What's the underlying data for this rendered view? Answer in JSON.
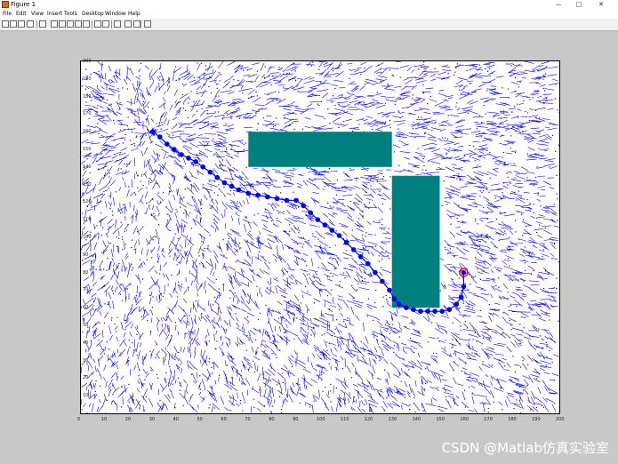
{
  "window": {
    "title": "Figure 1",
    "minimize": "—",
    "maximize": "□",
    "close": "✕"
  },
  "menu": [
    "File",
    "Edit",
    "View",
    "Insert",
    "Tools",
    "Desktop",
    "Window",
    "Help"
  ],
  "toolbar_icons": [
    "new-file-icon",
    "open-icon",
    "save-icon",
    "print-icon",
    "pointer-icon",
    "zoom-in-icon",
    "zoom-out-icon",
    "pan-icon",
    "rotate-icon",
    "data-cursor-icon",
    "brush-icon",
    "link-icon",
    "colorbar-icon",
    "legend-icon",
    "hide-plot-tools-icon",
    "show-plot-tools-icon"
  ],
  "chart_data": {
    "type": "scatter",
    "xlim": [
      0,
      200
    ],
    "ylim": [
      0,
      200
    ],
    "xticks": [
      "0",
      "10",
      "20",
      "30",
      "40",
      "50",
      "60",
      "70",
      "80",
      "90",
      "100",
      "110",
      "120",
      "130",
      "140",
      "150",
      "160",
      "170",
      "180",
      "190",
      "200"
    ],
    "yticks": [
      "0",
      "10",
      "20",
      "30",
      "40",
      "50",
      "60",
      "70",
      "80",
      "90",
      "100",
      "110",
      "120",
      "130",
      "140",
      "150",
      "160",
      "170",
      "180",
      "190",
      "200"
    ],
    "start_label": "",
    "start": [
      30,
      160
    ],
    "goal": [
      160,
      80
    ],
    "obstacles": [
      {
        "x": [
          70,
          130
        ],
        "y": [
          140,
          160
        ]
      },
      {
        "x": [
          130,
          150
        ],
        "y": [
          60,
          135
        ]
      }
    ],
    "obstacle_color": "#007f7f",
    "tree_color": "#0000ff",
    "path_color": "#0000ff",
    "goal_color": "#ff0000",
    "path": [
      [
        30,
        160
      ],
      [
        33,
        157
      ],
      [
        36,
        153
      ],
      [
        39,
        150
      ],
      [
        42,
        147
      ],
      [
        45,
        145
      ],
      [
        48,
        143
      ],
      [
        51,
        140
      ],
      [
        54,
        137
      ],
      [
        57,
        134
      ],
      [
        60,
        131
      ],
      [
        63,
        129
      ],
      [
        66,
        127
      ],
      [
        70,
        125
      ],
      [
        74,
        124
      ],
      [
        78,
        123
      ],
      [
        82,
        122
      ],
      [
        86,
        121
      ],
      [
        90,
        121
      ],
      [
        93,
        118
      ],
      [
        96,
        114
      ],
      [
        99,
        110
      ],
      [
        102,
        107
      ],
      [
        105,
        104
      ],
      [
        108,
        101
      ],
      [
        111,
        97
      ],
      [
        114,
        93
      ],
      [
        117,
        89
      ],
      [
        120,
        85
      ],
      [
        123,
        80
      ],
      [
        126,
        75
      ],
      [
        129,
        70
      ],
      [
        131,
        65
      ],
      [
        133,
        62
      ],
      [
        136,
        60
      ],
      [
        139,
        59
      ],
      [
        142,
        58
      ],
      [
        145,
        58
      ],
      [
        148,
        58
      ],
      [
        151,
        58
      ],
      [
        154,
        59
      ],
      [
        157,
        62
      ],
      [
        159,
        66
      ],
      [
        160,
        72
      ],
      [
        160,
        80
      ]
    ]
  },
  "watermark": "CSDN @Matlab仿真实验室"
}
